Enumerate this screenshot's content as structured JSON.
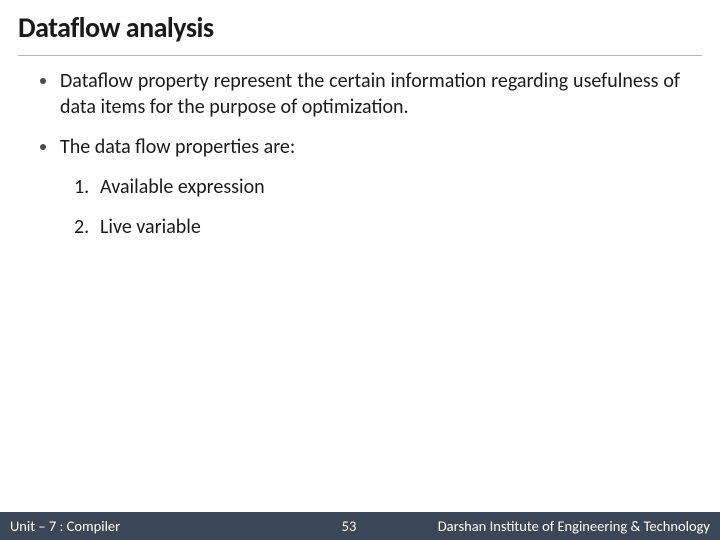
{
  "title": "Dataflow analysis",
  "bullets": [
    "Dataflow property represent the certain information regarding usefulness of data items for the purpose of optimization.",
    "The data flow properties are:"
  ],
  "numbered": [
    {
      "n": "1.",
      "text": "Available expression"
    },
    {
      "n": "2.",
      "text": "Live variable"
    }
  ],
  "footer": {
    "left": "Unit – 7  : Compiler",
    "page": "53",
    "right": "Darshan Institute of Engineering & Technology"
  }
}
